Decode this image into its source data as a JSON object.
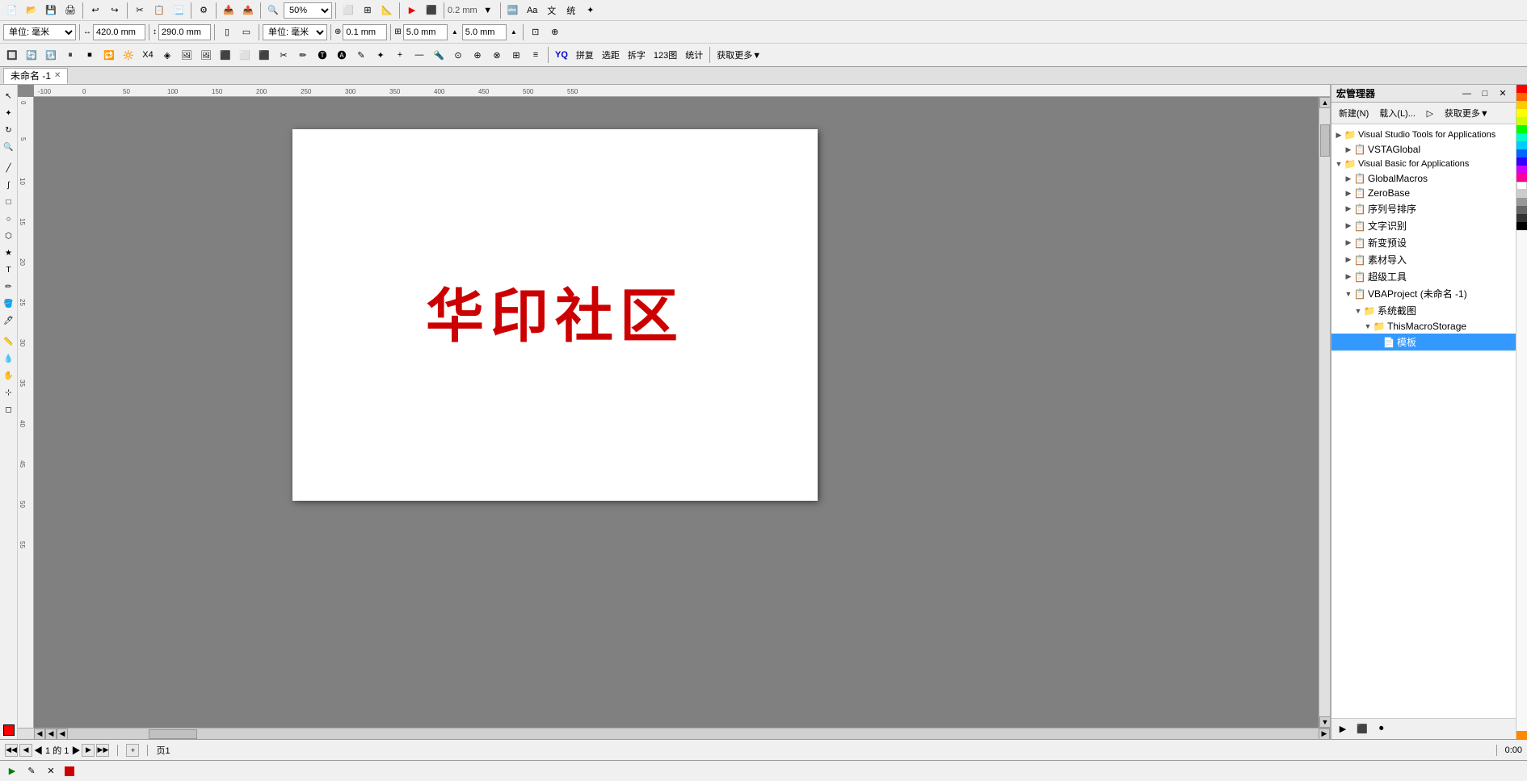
{
  "app": {
    "title": "宏管理器",
    "tab_name": "未命名 -1"
  },
  "toolbar1": {
    "zoom_value": "50%",
    "btn_labels": [
      "▣",
      "↩",
      "↪",
      "▤",
      "📄",
      "🖨",
      "✂",
      "📋",
      "📃",
      "⚙",
      "▶",
      "⬛"
    ],
    "zoom_label": "50%"
  },
  "toolbar2": {
    "width_label": "420.0 mm",
    "height_label": "290.0 mm",
    "unit_label": "单位: 毫米",
    "step1_label": "0.1 mm",
    "step2_label": "5.0 mm",
    "step3_label": "5.0 mm"
  },
  "toolbar3": {
    "btns": [
      "YQ",
      "拼复",
      "选距",
      "拆字",
      "123图",
      "统计",
      "⊞"
    ]
  },
  "canvas": {
    "page_text": "华印社区",
    "ruler_unit": "毫米"
  },
  "statusbar": {
    "page_info": "◀ ◀  ◀ 1 的 1 ▶  ▶▶",
    "page_label": "页1",
    "coords": "0:00"
  },
  "macro_panel": {
    "title": "宏管理器",
    "btn_new": "新建(N)",
    "btn_load": "载入(L)...",
    "btn_run": "▶",
    "btn_get_more": "获取更多▼",
    "tree": [
      {
        "id": "vsta-tools",
        "label": "Visual Studio Tools for Applications",
        "icon": "folder",
        "expanded": true,
        "indent": 0,
        "children": [
          {
            "id": "vsta-global",
            "label": "VSTAGlobal",
            "icon": "module",
            "indent": 1
          }
        ]
      },
      {
        "id": "vba",
        "label": "Visual Basic for Applications",
        "icon": "folder",
        "expanded": true,
        "indent": 0,
        "children": [
          {
            "id": "global-macros",
            "label": "GlobalMacros",
            "icon": "module",
            "indent": 1
          },
          {
            "id": "zero-base",
            "label": "ZeroBase",
            "icon": "module",
            "indent": 1
          },
          {
            "id": "serial-sort",
            "label": "序列号排序",
            "icon": "module",
            "indent": 1
          },
          {
            "id": "text-recog",
            "label": "文字识别",
            "icon": "module",
            "indent": 1
          },
          {
            "id": "new-var",
            "label": "新变预设",
            "icon": "module",
            "indent": 1
          },
          {
            "id": "material-import",
            "label": "素材导入",
            "icon": "module",
            "indent": 1
          },
          {
            "id": "super-tools",
            "label": "超级工具",
            "icon": "module",
            "indent": 1
          },
          {
            "id": "vba-project",
            "label": "VBAProject (未命名 -1)",
            "icon": "module",
            "indent": 1,
            "expanded": true,
            "children": [
              {
                "id": "system-view",
                "label": "系统截图",
                "icon": "folder",
                "indent": 2,
                "expanded": true,
                "children": [
                  {
                    "id": "this-macro",
                    "label": "ThisMacroStorage",
                    "icon": "folder",
                    "indent": 3,
                    "expanded": true,
                    "children": [
                      {
                        "id": "doc-module",
                        "label": "模板",
                        "icon": "doc-module",
                        "indent": 4,
                        "selected": true
                      }
                    ]
                  }
                ]
              }
            ]
          }
        ]
      }
    ]
  },
  "colors": {
    "strip": [
      "#ff0000",
      "#ff6600",
      "#ffcc00",
      "#ffff00",
      "#ccff00",
      "#00ff00",
      "#00ffcc",
      "#00ccff",
      "#0066ff",
      "#3300ff",
      "#cc00ff",
      "#ff0099",
      "#ffffff",
      "#cccccc",
      "#999999",
      "#666666",
      "#333333",
      "#000000"
    ]
  }
}
